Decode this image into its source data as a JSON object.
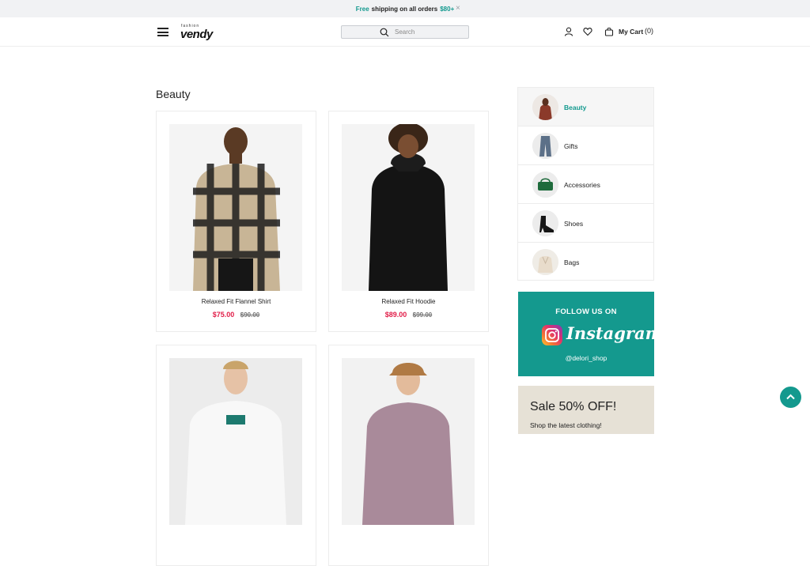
{
  "announcement": {
    "prefix": "Free",
    "middle": "shipping on all orders",
    "amount": "$80+",
    "close_glyph": "×"
  },
  "header": {
    "logo_small": "fashion",
    "logo_big": "vendy",
    "search_placeholder": "Search",
    "cart_label": "My Cart",
    "cart_count": "(0)"
  },
  "main": {
    "title": "Beauty",
    "products": [
      {
        "name": "Relaxed Fit Flannel Shirt",
        "price": "$75.00",
        "old_price": "$90.00"
      },
      {
        "name": "Relaxed Fit Hoodie",
        "price": "$89.00",
        "old_price": "$99.00"
      },
      {
        "name": "",
        "price": "",
        "old_price": ""
      },
      {
        "name": "",
        "price": "",
        "old_price": ""
      }
    ]
  },
  "sidebar": {
    "categories": [
      {
        "label": "Beauty"
      },
      {
        "label": "Gifts"
      },
      {
        "label": "Accessories"
      },
      {
        "label": "Shoes"
      },
      {
        "label": "Bags"
      }
    ],
    "instagram": {
      "follow_text": "FOLLOW US ON",
      "brand": "Instagram",
      "handle": "@delori_shop"
    },
    "sale": {
      "headline": "Sale 50% OFF!",
      "subline": "Shop the latest clothing!"
    }
  },
  "colors": {
    "accent": "#14998e",
    "price": "#e11d48"
  }
}
